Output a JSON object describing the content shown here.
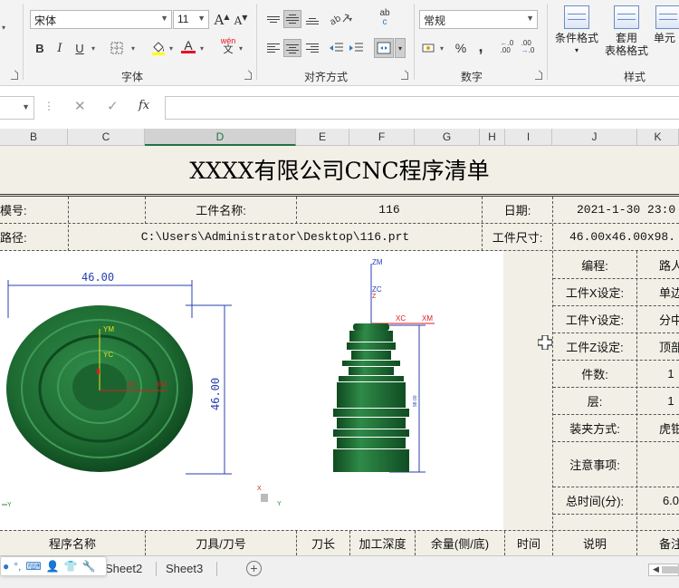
{
  "ribbon": {
    "font_group": {
      "font_name": "宋体",
      "font_size": "11",
      "grow_label": "A",
      "shrink_label": "A",
      "bold": "B",
      "italic": "I",
      "underline": "U",
      "font_color_label": "A",
      "phonetic_label": "wén",
      "phonetic_sub": "文",
      "label": "字体"
    },
    "align_group": {
      "label": "对齐方式",
      "wrap_label": "ab",
      "wrap_sub": "c"
    },
    "number_group": {
      "format": "常规",
      "percent": "%",
      "comma": ",",
      "dec_inc": "←.0\n.00",
      "dec_dec": ".00\n→.0",
      "label": "数字"
    },
    "style_group": {
      "conditional": "条件格式",
      "table_format_1": "套用",
      "table_format_2": "表格格式",
      "cell_style": "单元",
      "label": "样式"
    }
  },
  "formula_bar": {
    "cancel": "✕",
    "confirm": "✓",
    "fx": "fx",
    "value": ""
  },
  "columns": [
    {
      "id": "B",
      "selected": false
    },
    {
      "id": "C",
      "selected": false
    },
    {
      "id": "D",
      "selected": true
    },
    {
      "id": "E",
      "selected": false
    },
    {
      "id": "F",
      "selected": false
    },
    {
      "id": "G",
      "selected": false
    },
    {
      "id": "H",
      "selected": false
    },
    {
      "id": "I",
      "selected": false
    },
    {
      "id": "J",
      "selected": false
    },
    {
      "id": "K",
      "selected": false
    }
  ],
  "sheet": {
    "title": "XXXX有限公司CNC程序清单",
    "row1": {
      "mold_label": "模号:",
      "mold_value": "",
      "part_label": "工件名称:",
      "part_value": "116",
      "date_label": "日期:",
      "date_value": "2021-1-30 23:0"
    },
    "row2": {
      "path_label": "路径:",
      "path_value": "C:\\Users\\Administrator\\Desktop\\116.prt",
      "size_label": "工件尺寸:",
      "size_value": "46.00x46.00x98."
    },
    "side": [
      {
        "label": "编程:",
        "value": "路人"
      },
      {
        "label": "工件X设定:",
        "value": "单边"
      },
      {
        "label": "工件Y设定:",
        "value": "分中"
      },
      {
        "label": "工件Z设定:",
        "value": "顶部"
      },
      {
        "label": "件数:",
        "value": "1"
      },
      {
        "label": "层:",
        "value": "1"
      },
      {
        "label": "装夹方式:",
        "value": "虎钳"
      },
      {
        "label": "注意事项:",
        "value": ""
      },
      {
        "label": "总时间(分):",
        "value": "6.0"
      }
    ],
    "headers": [
      "程序名称",
      "刀具/刀号",
      "刀长",
      "加工深度",
      "余量(侧/底)",
      "时间",
      "说明",
      "备注"
    ],
    "drawing": {
      "dim_top": "46.00",
      "dim_side": "46.00",
      "dim_height": "98.00",
      "ym": "YM",
      "yc": "YC",
      "xc": "XC",
      "xm": "XM",
      "zm": "ZM",
      "zc": "ZC",
      "z": "Z",
      "x": "X",
      "y": "Y"
    }
  },
  "tabs": {
    "sheet2": "Sheet2",
    "sheet3": "Sheet3",
    "add": "+"
  },
  "colors": {
    "part_green": "#1e6b32",
    "dim_blue": "#2a3fb0",
    "axis_red": "#d81e1e",
    "excel_green": "#217346"
  }
}
